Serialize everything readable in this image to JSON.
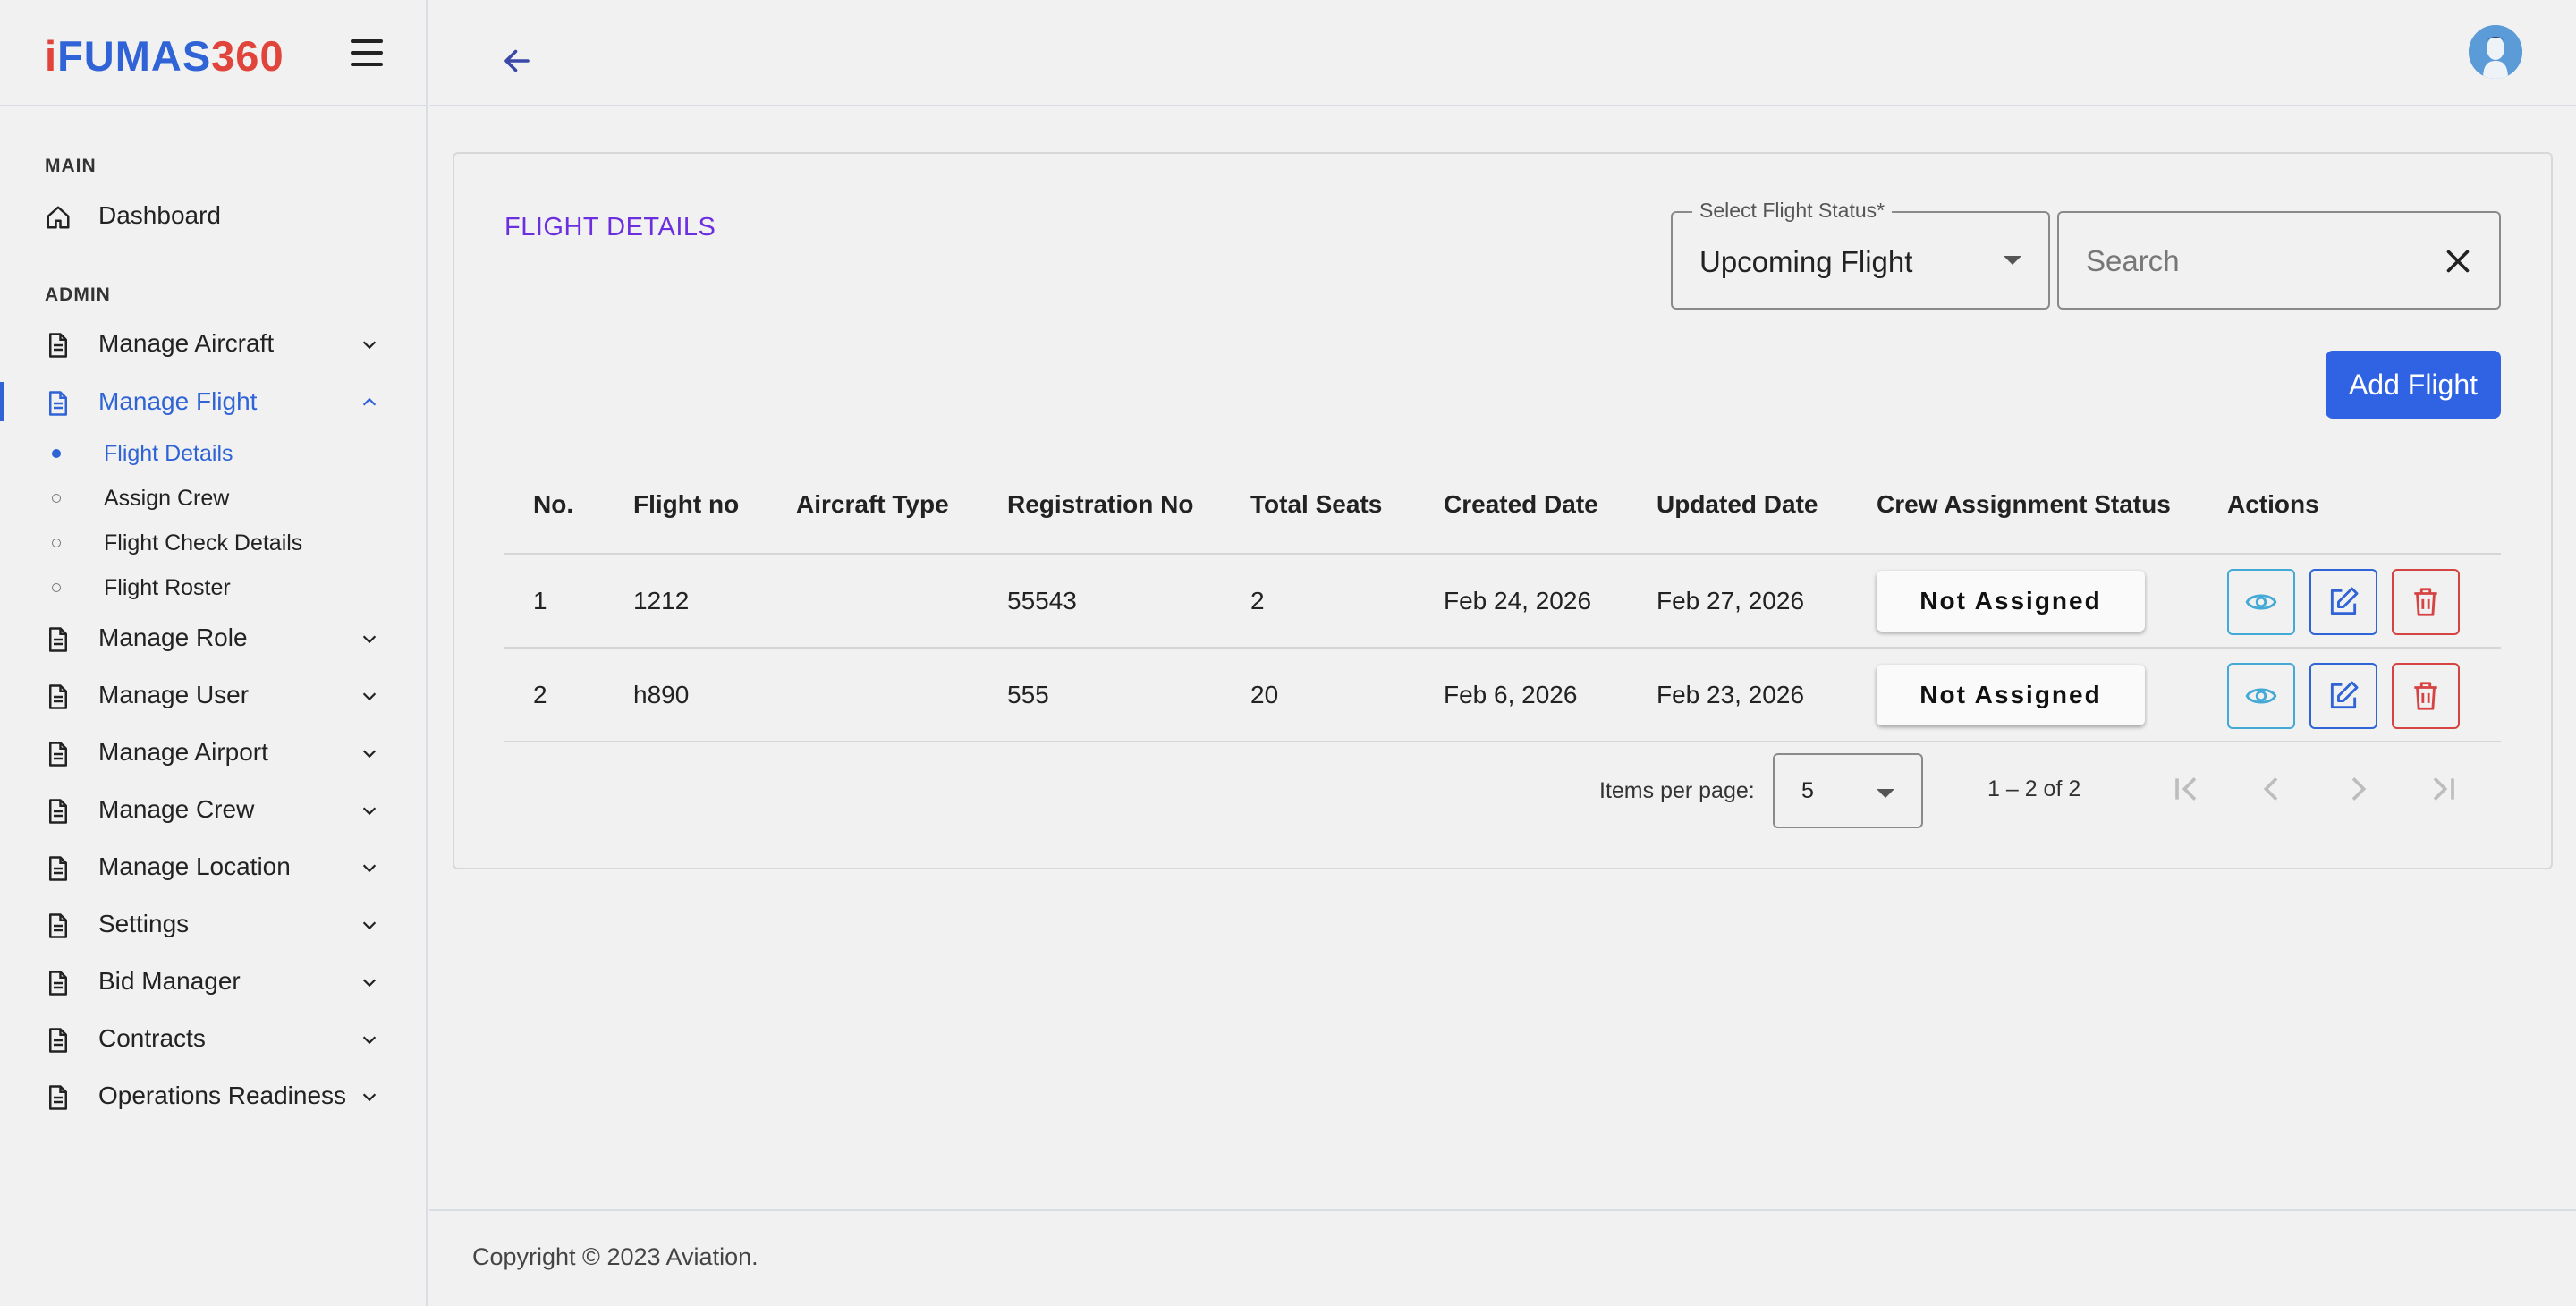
{
  "brand": {
    "logo_prefix": "i",
    "logo_f": "F",
    "logo_mid": "UMAS",
    "logo_num": "360"
  },
  "sidebar": {
    "main_label": "MAIN",
    "admin_label": "ADMIN",
    "dashboard": "Dashboard",
    "items": [
      {
        "label": "Manage Aircraft"
      },
      {
        "label": "Manage Flight"
      },
      {
        "label": "Manage Role"
      },
      {
        "label": "Manage User"
      },
      {
        "label": "Manage Airport"
      },
      {
        "label": "Manage Crew"
      },
      {
        "label": "Manage Location"
      },
      {
        "label": "Settings"
      },
      {
        "label": "Bid Manager"
      },
      {
        "label": "Contracts"
      },
      {
        "label": "Operations Readiness"
      }
    ],
    "sub_items": [
      {
        "label": "Flight Details"
      },
      {
        "label": "Assign Crew"
      },
      {
        "label": "Flight Check Details"
      },
      {
        "label": "Flight Roster"
      }
    ]
  },
  "main": {
    "title": "FLIGHT DETAILS",
    "status_select": {
      "label": "Select Flight Status*",
      "value": "Upcoming Flight"
    },
    "search": {
      "placeholder": "Search"
    },
    "add_button": "Add Flight"
  },
  "table": {
    "columns": [
      "No.",
      "Flight no",
      "Aircraft Type",
      "Registration No",
      "Total Seats",
      "Created Date",
      "Updated Date",
      "Crew Assignment Status",
      "Actions"
    ],
    "rows": [
      {
        "no": "1",
        "flight_no": "1212",
        "aircraft_type": "",
        "registration_no": "55543",
        "total_seats": "2",
        "created": "Feb 24, 2026",
        "updated": "Feb 27, 2026",
        "crew_status": "Not Assigned"
      },
      {
        "no": "2",
        "flight_no": "h890",
        "aircraft_type": "",
        "registration_no": "555",
        "total_seats": "20",
        "created": "Feb 6, 2026",
        "updated": "Feb 23, 2026",
        "crew_status": "Not Assigned"
      }
    ]
  },
  "paginator": {
    "items_label": "Items per page:",
    "page_size": "5",
    "range": "1 – 2 of 2"
  },
  "footer": {
    "text": "Copyright © 2023 Aviation."
  },
  "colors": {
    "accent": "#2f63d6",
    "title": "#6b2fe0",
    "danger": "#d64343",
    "view": "#43a9d6"
  }
}
